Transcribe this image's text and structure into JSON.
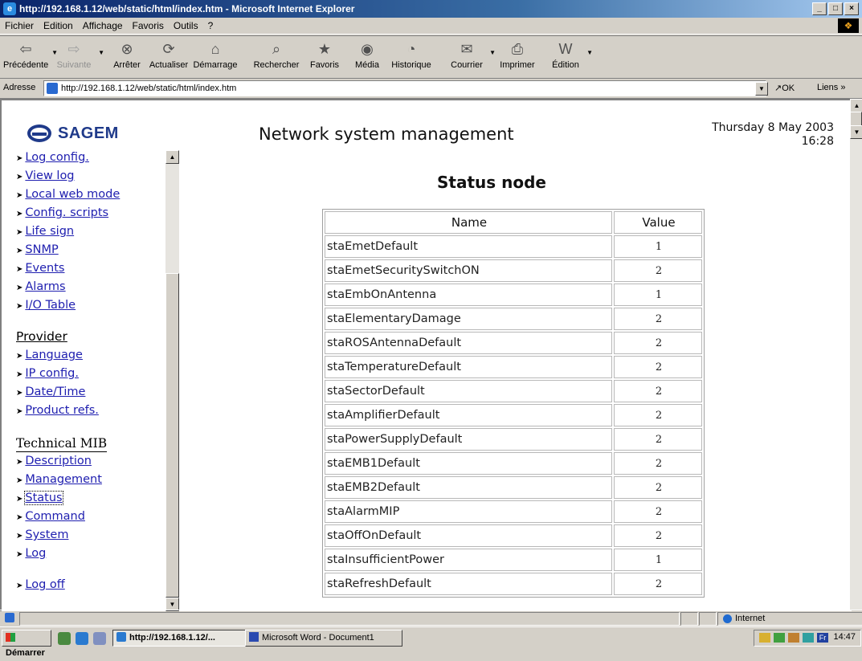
{
  "window": {
    "title": "http://192.168.1.12/web/static/html/index.htm - Microsoft Internet Explorer",
    "controls": [
      "_",
      "□",
      "×"
    ]
  },
  "menu": [
    "Fichier",
    "Edition",
    "Affichage",
    "Favoris",
    "Outils",
    "?"
  ],
  "toolbar": [
    {
      "label": "Précédente",
      "icon": "back-arrow-icon",
      "glyph": "⇦",
      "enabled": true,
      "dropdown": true
    },
    {
      "label": "Suivante",
      "icon": "forward-arrow-icon",
      "glyph": "⇨",
      "enabled": false,
      "dropdown": true
    },
    {
      "label": "Arrêter",
      "icon": "stop-icon",
      "glyph": "⊗",
      "enabled": true
    },
    {
      "label": "Actualiser",
      "icon": "refresh-icon",
      "glyph": "⟳",
      "enabled": true
    },
    {
      "label": "Démarrage",
      "icon": "home-icon",
      "glyph": "⌂",
      "enabled": true
    },
    {
      "label": "Rechercher",
      "icon": "search-icon",
      "glyph": "⌕",
      "enabled": true
    },
    {
      "label": "Favoris",
      "icon": "favorites-icon",
      "glyph": "★",
      "enabled": true
    },
    {
      "label": "Média",
      "icon": "media-icon",
      "glyph": "◉",
      "enabled": true
    },
    {
      "label": "Historique",
      "icon": "history-icon",
      "glyph": "◔",
      "enabled": true
    },
    {
      "label": "Courrier",
      "icon": "mail-icon",
      "glyph": "✉",
      "enabled": true,
      "dropdown": true
    },
    {
      "label": "Imprimer",
      "icon": "print-icon",
      "glyph": "⎙",
      "enabled": true
    },
    {
      "label": "Édition",
      "icon": "edit-icon",
      "glyph": "W",
      "enabled": true,
      "dropdown": true
    }
  ],
  "address": {
    "label": "Adresse",
    "url": "http://192.168.1.12/web/static/html/index.htm",
    "go": "OK",
    "links": "Liens »"
  },
  "header": {
    "logo_text": "SAGEM",
    "title": "Network system management",
    "date": "Thursday 8 May 2003",
    "time": "16:28"
  },
  "nav": {
    "group1": [
      "Log config.",
      "View log",
      "Local web mode",
      "Config. scripts",
      "Life sign",
      "SNMP",
      "Events",
      "Alarms",
      "I/O Table"
    ],
    "provider_heading": "Provider",
    "provider": [
      "Language",
      "IP config.",
      "Date/Time",
      "Product refs."
    ],
    "tmib_heading": "Technical MIB",
    "tmib": [
      "Description",
      "Management",
      "Status",
      "Command",
      "System",
      "Log"
    ],
    "logoff": "Log off"
  },
  "status_table": {
    "title": "Status node",
    "columns": [
      "Name",
      "Value"
    ],
    "rows": [
      [
        "staEmetDefault",
        "1"
      ],
      [
        "staEmetSecuritySwitchON",
        "2"
      ],
      [
        "staEmbOnAntenna",
        "1"
      ],
      [
        "staElementaryDamage",
        "2"
      ],
      [
        "staROSAntennaDefault",
        "2"
      ],
      [
        "staTemperatureDefault",
        "2"
      ],
      [
        "staSectorDefault",
        "2"
      ],
      [
        "staAmplifierDefault",
        "2"
      ],
      [
        "staPowerSupplyDefault",
        "2"
      ],
      [
        "staEMB1Default",
        "2"
      ],
      [
        "staEMB2Default",
        "2"
      ],
      [
        "staAlarmMIP",
        "2"
      ],
      [
        "staOffOnDefault",
        "2"
      ],
      [
        "staInsufficientPower",
        "1"
      ],
      [
        "staRefreshDefault",
        "2"
      ]
    ]
  },
  "statusbar": {
    "zone": "Internet"
  },
  "taskbar": {
    "start": "Démarrer",
    "tasks": [
      {
        "label": "http://192.168.1.12/...",
        "active": true
      },
      {
        "label": "Microsoft Word - Document1",
        "active": false
      }
    ],
    "clock": "14:47"
  }
}
